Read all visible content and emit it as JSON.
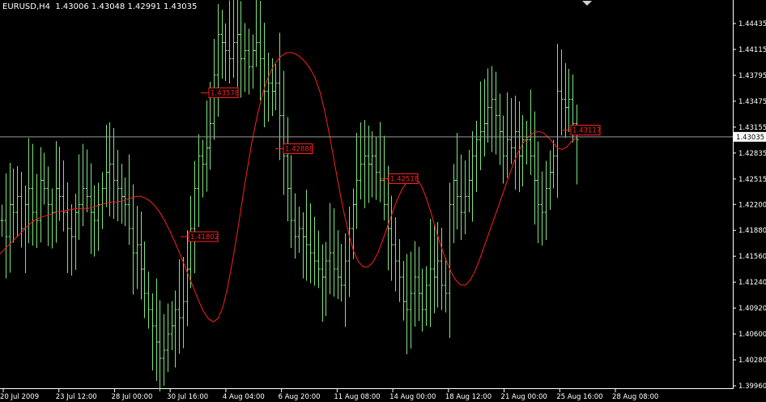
{
  "header": {
    "symbol": "EURUSD,H4",
    "open": "1.43006",
    "high": "1.43048",
    "low": "1.42991",
    "close": "1.43035"
  },
  "colors": {
    "background": "#000000",
    "bars": "#7fe57f",
    "ma_line": "#ff2020",
    "price_line": "#9a9a9a",
    "axis": "#ffffff"
  },
  "chart_data": {
    "type": "ohlc-bar",
    "title": "EURUSD,H4",
    "ylim": [
      1.3996,
      1.446
    ],
    "y_ticks": [
      "1.44435",
      "1.44115",
      "1.43795",
      "1.43475",
      "1.43155",
      "1.42835",
      "1.42515",
      "1.42200",
      "1.41880",
      "1.41560",
      "1.41240",
      "1.40920",
      "1.40600",
      "1.40280",
      "1.39960"
    ],
    "x_ticks": [
      "20 Jul 2009",
      "23 Jul 12:00",
      "28 Jul 00:00",
      "30 Jul 16:00",
      "4 Aug 04:00",
      "6 Aug 20:00",
      "11 Aug 08:00",
      "14 Aug 00:00",
      "18 Aug 12:00",
      "21 Aug 00:00",
      "25 Aug 16:00",
      "28 Aug 08:00"
    ],
    "current_price": "1.43035",
    "close_series": [
      1.42,
      1.418,
      1.422,
      1.421,
      1.423,
      1.419,
      1.422,
      1.424,
      1.421,
      1.42,
      1.425,
      1.424,
      1.422,
      1.421,
      1.424,
      1.423,
      1.421,
      1.419,
      1.418,
      1.421,
      1.422,
      1.424,
      1.423,
      1.421,
      1.42,
      1.422,
      1.424,
      1.426,
      1.427,
      1.425,
      1.424,
      1.423,
      1.422,
      1.419,
      1.416,
      1.417,
      1.414,
      1.411,
      1.409,
      1.407,
      1.405,
      1.403,
      1.404,
      1.406,
      1.407,
      1.409,
      1.408,
      1.41,
      1.414,
      1.419,
      1.424,
      1.428,
      1.427,
      1.429,
      1.432,
      1.438,
      1.443,
      1.442,
      1.441,
      1.44,
      1.442,
      1.443,
      1.44,
      1.441,
      1.439,
      1.441,
      1.442,
      1.44,
      1.436,
      1.437,
      1.436,
      1.437,
      1.433,
      1.428,
      1.424,
      1.42,
      1.418,
      1.419,
      1.418,
      1.417,
      1.416,
      1.415,
      1.414,
      1.413,
      1.415,
      1.416,
      1.414,
      1.413,
      1.412,
      1.415,
      1.419,
      1.422,
      1.425,
      1.427,
      1.428,
      1.427,
      1.428,
      1.426,
      1.425,
      1.422,
      1.419,
      1.417,
      1.415,
      1.413,
      1.41,
      1.409,
      1.411,
      1.413,
      1.411,
      1.409,
      1.412,
      1.414,
      1.413,
      1.415,
      1.412,
      1.411,
      1.422,
      1.425,
      1.423,
      1.421,
      1.423,
      1.425,
      1.428,
      1.43,
      1.431,
      1.432,
      1.434,
      1.435,
      1.433,
      1.431,
      1.428,
      1.43,
      1.429,
      1.431,
      1.428,
      1.43,
      1.43,
      1.428,
      1.425,
      1.422,
      1.421,
      1.424,
      1.426,
      1.428,
      1.436,
      1.435,
      1.434,
      1.435,
      1.432,
      1.43
    ],
    "ma_series": [
      1.4159,
      1.4165,
      1.4171,
      1.4177,
      1.4183,
      1.4189,
      1.4195,
      1.42,
      1.4203,
      1.4205,
      1.4207,
      1.4209,
      1.4211,
      1.4212,
      1.4213,
      1.4214,
      1.4215,
      1.4215,
      1.4215,
      1.4216,
      1.4218,
      1.422,
      1.4222,
      1.4223,
      1.4223,
      1.4224,
      1.4226,
      1.4228,
      1.423,
      1.423,
      1.4228,
      1.4224,
      1.4218,
      1.421,
      1.42,
      1.4188,
      1.4175,
      1.4161,
      1.4146,
      1.4131,
      1.4116,
      1.4101,
      1.4088,
      1.4079,
      1.4075,
      1.4079,
      1.4093,
      1.4118,
      1.415,
      1.4186,
      1.4225,
      1.4262,
      1.4297,
      1.4327,
      1.4352,
      1.4372,
      1.4386,
      1.4396,
      1.4403,
      1.4407,
      1.4408,
      1.4406,
      1.4402,
      1.4396,
      1.4388,
      1.4377,
      1.436,
      1.4336,
      1.4306,
      1.4273,
      1.424,
      1.421,
      1.4183,
      1.4162,
      1.4149,
      1.4143,
      1.4143,
      1.4149,
      1.416,
      1.4176,
      1.4193,
      1.421,
      1.4226,
      1.4239,
      1.4248,
      1.4252,
      1.4251,
      1.4243,
      1.4228,
      1.4209,
      1.4188,
      1.4169,
      1.4152,
      1.4138,
      1.4127,
      1.4121,
      1.412,
      1.4126,
      1.4137,
      1.4152,
      1.4169,
      1.4186,
      1.4203,
      1.422,
      1.4237,
      1.4254,
      1.4271,
      1.4285,
      1.4296,
      1.4303,
      1.4308,
      1.431,
      1.4309,
      1.4304,
      1.4297,
      1.429,
      1.4288,
      1.4291,
      1.4298,
      1.4302
    ],
    "ma_labels": [
      {
        "text": "1.43578",
        "value": 1.43578
      },
      {
        "text": "1.42888",
        "value": 1.42888
      },
      {
        "text": "1.42518",
        "value": 1.42518
      },
      {
        "text": "1.41802",
        "value": 1.41802
      },
      {
        "text": "1.43117",
        "value": 1.43117
      }
    ]
  }
}
